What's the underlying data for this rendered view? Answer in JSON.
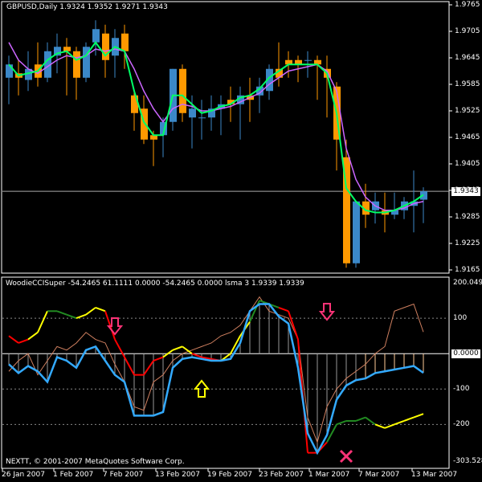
{
  "price_panel": {
    "header": "GBPUSD,Daily  1.9324 1.9352 1.9271 1.9343",
    "axis_labels": [
      "1.9765",
      "1.9705",
      "1.9645",
      "1.9585",
      "1.9525",
      "1.9465",
      "1.9405",
      "1.9345",
      "1.9285",
      "1.9225",
      "1.9165"
    ],
    "current_price": "1.9343"
  },
  "cci_panel": {
    "header": "WoodieCCISuper -54.2465 61.1111 0.0000 -54.2465 0.0000  lsma 3 1.9339 1.9339",
    "axis_labels": [
      "200.0491",
      "100",
      "-100",
      "-200",
      "-303.528"
    ],
    "zero_label": "0.0000"
  },
  "date_axis": [
    "26 Jan 2007",
    "1 Feb 2007",
    "7 Feb 2007",
    "13 Feb 2007",
    "19 Feb 2007",
    "23 Feb 2007",
    "1 Mar 2007",
    "7 Mar 2007",
    "13 Mar 2007"
  ],
  "footer": "NEXTT, © 2001-2007 MetaQuotes Software Corp.",
  "colors": {
    "bull": "#3b88c8",
    "bear": "#ff9900",
    "fast_ma": "#00ff66",
    "slow_ma": "#cc66ff",
    "cci_blue": "#33aaff",
    "cci_green": "#228b22",
    "cci_yellow": "#ffff00",
    "cci_red": "#ff0000",
    "turbo": "#d08060",
    "hist_up": "#ffcc99",
    "hist_dn": "#999999",
    "arrow_down": "#ff3377",
    "arrow_up": "#ffff00"
  },
  "chart_data": {
    "type": "candlestick",
    "symbol": "GBPUSD",
    "timeframe": "Daily",
    "ylim": [
      1.9165,
      1.9765
    ],
    "candles": [
      {
        "o": 1.96,
        "h": 1.965,
        "l": 1.954,
        "c": 1.963
      },
      {
        "o": 1.961,
        "h": 1.964,
        "l": 1.956,
        "c": 1.96
      },
      {
        "o": 1.9595,
        "h": 1.966,
        "l": 1.957,
        "c": 1.962
      },
      {
        "o": 1.963,
        "h": 1.968,
        "l": 1.958,
        "c": 1.96
      },
      {
        "o": 1.96,
        "h": 1.968,
        "l": 1.959,
        "c": 1.966
      },
      {
        "o": 1.965,
        "h": 1.97,
        "l": 1.961,
        "c": 1.967
      },
      {
        "o": 1.967,
        "h": 1.969,
        "l": 1.956,
        "c": 1.966
      },
      {
        "o": 1.966,
        "h": 1.967,
        "l": 1.955,
        "c": 1.96
      },
      {
        "o": 1.96,
        "h": 1.968,
        "l": 1.959,
        "c": 1.967
      },
      {
        "o": 1.968,
        "h": 1.973,
        "l": 1.965,
        "c": 1.971
      },
      {
        "o": 1.97,
        "h": 1.972,
        "l": 1.96,
        "c": 1.964
      },
      {
        "o": 1.965,
        "h": 1.971,
        "l": 1.96,
        "c": 1.969
      },
      {
        "o": 1.97,
        "h": 1.972,
        "l": 1.962,
        "c": 1.966
      },
      {
        "o": 1.956,
        "h": 1.957,
        "l": 1.948,
        "c": 1.952
      },
      {
        "o": 1.953,
        "h": 1.956,
        "l": 1.945,
        "c": 1.946
      },
      {
        "o": 1.947,
        "h": 1.948,
        "l": 1.94,
        "c": 1.946
      },
      {
        "o": 1.947,
        "h": 1.951,
        "l": 1.942,
        "c": 1.95
      },
      {
        "o": 1.95,
        "h": 1.962,
        "l": 1.948,
        "c": 1.962
      },
      {
        "o": 1.962,
        "h": 1.963,
        "l": 1.95,
        "c": 1.952
      },
      {
        "o": 1.951,
        "h": 1.956,
        "l": 1.944,
        "c": 1.953
      },
      {
        "o": 1.951,
        "h": 1.955,
        "l": 1.946,
        "c": 1.951
      },
      {
        "o": 1.951,
        "h": 1.956,
        "l": 1.948,
        "c": 1.953
      },
      {
        "o": 1.953,
        "h": 1.956,
        "l": 1.947,
        "c": 1.954
      },
      {
        "o": 1.955,
        "h": 1.958,
        "l": 1.95,
        "c": 1.954
      },
      {
        "o": 1.954,
        "h": 1.958,
        "l": 1.946,
        "c": 1.956
      },
      {
        "o": 1.956,
        "h": 1.96,
        "l": 1.95,
        "c": 1.955
      },
      {
        "o": 1.956,
        "h": 1.96,
        "l": 1.952,
        "c": 1.958
      },
      {
        "o": 1.957,
        "h": 1.963,
        "l": 1.955,
        "c": 1.962
      },
      {
        "o": 1.962,
        "h": 1.968,
        "l": 1.958,
        "c": 1.96
      },
      {
        "o": 1.964,
        "h": 1.966,
        "l": 1.96,
        "c": 1.963
      },
      {
        "o": 1.964,
        "h": 1.965,
        "l": 1.959,
        "c": 1.963
      },
      {
        "o": 1.964,
        "h": 1.966,
        "l": 1.96,
        "c": 1.964
      },
      {
        "o": 1.964,
        "h": 1.965,
        "l": 1.955,
        "c": 1.963
      },
      {
        "o": 1.962,
        "h": 1.965,
        "l": 1.951,
        "c": 1.96
      },
      {
        "o": 1.958,
        "h": 1.959,
        "l": 1.939,
        "c": 1.946
      },
      {
        "o": 1.942,
        "h": 1.946,
        "l": 1.917,
        "c": 1.918
      },
      {
        "o": 1.918,
        "h": 1.931,
        "l": 1.917,
        "c": 1.932
      },
      {
        "o": 1.932,
        "h": 1.936,
        "l": 1.926,
        "c": 1.929
      },
      {
        "o": 1.93,
        "h": 1.934,
        "l": 1.927,
        "c": 1.932
      },
      {
        "o": 1.93,
        "h": 1.934,
        "l": 1.925,
        "c": 1.929
      },
      {
        "o": 1.929,
        "h": 1.934,
        "l": 1.928,
        "c": 1.93
      },
      {
        "o": 1.93,
        "h": 1.933,
        "l": 1.928,
        "c": 1.932
      },
      {
        "o": 1.931,
        "h": 1.939,
        "l": 1.925,
        "c": 1.932
      },
      {
        "o": 1.9324,
        "h": 1.9352,
        "l": 1.9271,
        "c": 1.9343
      }
    ],
    "fast_ma": [
      1.963,
      1.9605,
      1.961,
      1.9615,
      1.964,
      1.9655,
      1.966,
      1.964,
      1.965,
      1.968,
      1.965,
      1.967,
      1.966,
      1.957,
      1.95,
      1.947,
      1.947,
      1.956,
      1.956,
      1.954,
      1.952,
      1.9525,
      1.9535,
      1.954,
      1.9555,
      1.956,
      1.9575,
      1.96,
      1.9615,
      1.963,
      1.963,
      1.963,
      1.963,
      1.961,
      1.952,
      1.935,
      1.932,
      1.93,
      1.9295,
      1.9295,
      1.93,
      1.931,
      1.932,
      1.9335
    ],
    "slow_ma": [
      1.968,
      1.964,
      1.962,
      1.961,
      1.9625,
      1.964,
      1.965,
      1.9645,
      1.965,
      1.9665,
      1.966,
      1.9665,
      1.966,
      1.962,
      1.957,
      1.953,
      1.95,
      1.953,
      1.954,
      1.9535,
      1.9525,
      1.9525,
      1.953,
      1.9535,
      1.9545,
      1.9555,
      1.9565,
      1.9585,
      1.96,
      1.9615,
      1.962,
      1.9625,
      1.963,
      1.9615,
      1.957,
      1.944,
      1.937,
      1.933,
      1.931,
      1.93,
      1.93,
      1.9305,
      1.9315,
      1.932
    ],
    "cci": {
      "ylim": [
        -303.528,
        200.0491
      ],
      "values": [
        -30,
        -55,
        -35,
        -50,
        -80,
        -10,
        -20,
        -40,
        10,
        20,
        -20,
        -60,
        -80,
        -175,
        -175,
        -175,
        -165,
        -40,
        -15,
        -10,
        -15,
        -20,
        -20,
        -15,
        30,
        120,
        140,
        140,
        105,
        85,
        -40,
        -225,
        -280,
        -230,
        -130,
        -90,
        -75,
        -70,
        -55,
        -50,
        -45,
        -40,
        -35,
        -54.2465
      ],
      "turbo": [
        -50,
        -20,
        0,
        -60,
        -20,
        20,
        10,
        30,
        60,
        40,
        30,
        -30,
        -80,
        -150,
        -160,
        -80,
        -60,
        -20,
        0,
        10,
        20,
        30,
        50,
        60,
        80,
        120,
        160,
        120,
        110,
        100,
        40,
        -180,
        -250,
        -150,
        -100,
        -70,
        -50,
        -30,
        0,
        20,
        120,
        130,
        140,
        61.1111
      ],
      "trend_line": [
        50,
        30,
        40,
        60,
        120,
        120,
        110,
        100,
        110,
        130,
        120,
        40,
        -10,
        -60,
        -60,
        -20,
        -10,
        10,
        20,
        0,
        -10,
        -15,
        -20,
        0,
        50,
        90,
        150,
        140,
        130,
        120,
        40,
        -280,
        -280,
        -250,
        -200,
        -190,
        -190,
        -180,
        -200,
        -210,
        -200,
        -190,
        -180,
        -170
      ]
    },
    "signals": {
      "down_arrows": [
        11,
        33
      ],
      "up_arrows": [
        20
      ],
      "cross": 35
    }
  }
}
